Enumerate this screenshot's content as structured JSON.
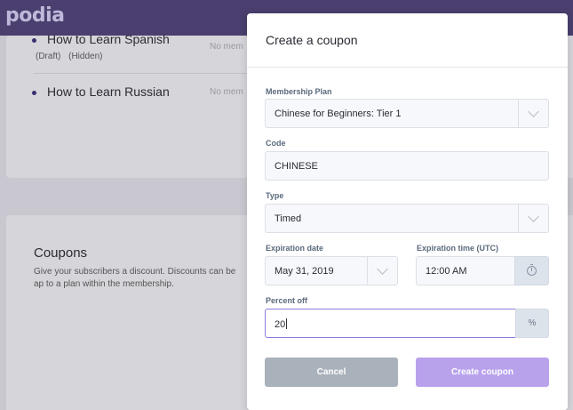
{
  "app": {
    "logo": "podia"
  },
  "background": {
    "lessons": [
      {
        "title": "How to Learn Spanish",
        "tags": [
          "(Draft)",
          "(Hidden)"
        ],
        "members": "No mem"
      },
      {
        "title": "How to Learn Russian",
        "members": "No mem"
      }
    ],
    "coupons": {
      "title": "Coupons",
      "description": "Give your subscribers a discount. Discounts can be ap to a plan within the membership."
    }
  },
  "modal": {
    "title": "Create a coupon",
    "membership_plan": {
      "label": "Membership Plan",
      "value": "Chinese for Beginners: Tier 1"
    },
    "code": {
      "label": "Code",
      "value": "CHINESE"
    },
    "type": {
      "label": "Type",
      "value": "Timed"
    },
    "expiration_date": {
      "label": "Expiration date",
      "value": "May 31, 2019"
    },
    "expiration_time": {
      "label": "Expiration time (UTC)",
      "value": "12:00 AM"
    },
    "percent_off": {
      "label": "Percent off",
      "value": "20",
      "unit": "%"
    },
    "cancel_label": "Cancel",
    "create_label": "Create coupon"
  },
  "colors": {
    "topbar": "#4a3f6e",
    "primary_button": "#b9a2ec",
    "cancel_button": "#a9b1bb",
    "focus_border": "#8e7be0"
  },
  "icons": [
    "chevron-down-icon",
    "clock-icon"
  ]
}
